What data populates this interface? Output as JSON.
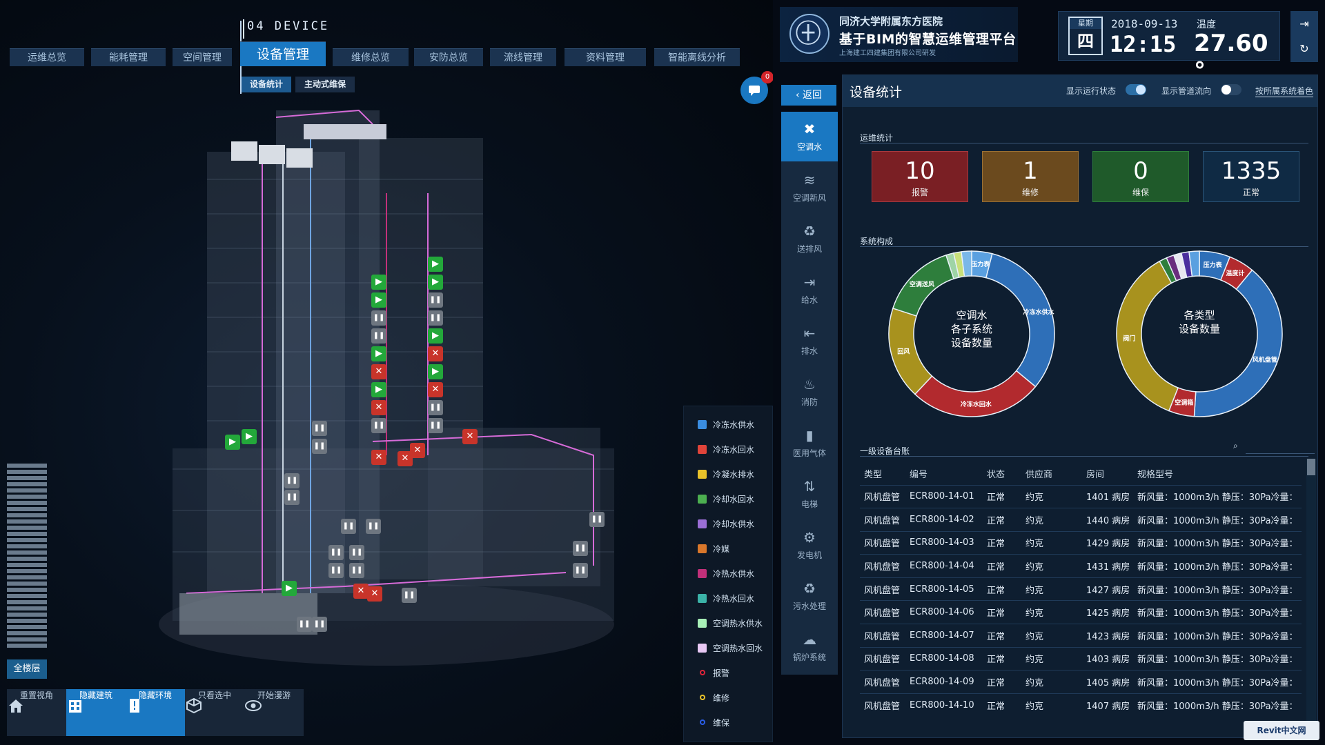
{
  "nav": {
    "device_label": "04 DEVICE",
    "tabs": [
      {
        "label": "运维总览",
        "active": false
      },
      {
        "label": "能耗管理",
        "active": false
      },
      {
        "label": "空间管理",
        "active": false
      },
      {
        "label": "设备管理",
        "active": true
      },
      {
        "label": "维修总览",
        "active": false
      },
      {
        "label": "安防总览",
        "active": false
      },
      {
        "label": "流线管理",
        "active": false
      },
      {
        "label": "资料管理",
        "active": false
      },
      {
        "label": "智能离线分析",
        "active": false
      }
    ],
    "subtabs": [
      {
        "label": "设备统计",
        "active": true
      },
      {
        "label": "主动式维保",
        "active": false
      }
    ]
  },
  "chat": {
    "badge": "0"
  },
  "header": {
    "hospital": "同济大学附属东方医院",
    "platform": "基于BIM的智慧运维管理平台",
    "company": "上海建工四建集团有限公司研发",
    "weekday_label": "星期",
    "weekday": "四",
    "date": "2018-09-13",
    "time": "12:15",
    "temp_label": "温度",
    "temp_value": "27.60 °"
  },
  "left": {
    "all_floors": "全楼层"
  },
  "toolbar": [
    {
      "label": "重置视角",
      "icon": "home-icon",
      "active": false
    },
    {
      "label": "隐藏建筑",
      "icon": "building-icon",
      "active": true
    },
    {
      "label": "隐藏环境",
      "icon": "environment-icon",
      "active": true
    },
    {
      "label": "只看选中",
      "icon": "cube-icon",
      "active": false
    },
    {
      "label": "开始漫游",
      "icon": "eye-icon",
      "active": false
    }
  ],
  "legend": [
    {
      "label": "冷冻水供水",
      "color": "#3a8de0",
      "kind": "swatch"
    },
    {
      "label": "冷冻水回水",
      "color": "#e0443a",
      "kind": "swatch"
    },
    {
      "label": "冷凝水排水",
      "color": "#e8c22a",
      "kind": "swatch"
    },
    {
      "label": "冷却水回水",
      "color": "#4caf50",
      "kind": "swatch"
    },
    {
      "label": "冷却水供水",
      "color": "#9b6fd6",
      "kind": "swatch"
    },
    {
      "label": "冷媒",
      "color": "#d9772b",
      "kind": "swatch"
    },
    {
      "label": "冷热水供水",
      "color": "#c2307a",
      "kind": "swatch"
    },
    {
      "label": "冷热水回水",
      "color": "#3bb3a8",
      "kind": "swatch"
    },
    {
      "label": "空调热水供水",
      "color": "#a8f0b8",
      "kind": "swatch"
    },
    {
      "label": "空调热水回水",
      "color": "#e8c8f4",
      "kind": "swatch"
    },
    {
      "label": "报警",
      "color": "#e0243a",
      "kind": "dot"
    },
    {
      "label": "维修",
      "color": "#e8c22a",
      "kind": "dot"
    },
    {
      "label": "维保",
      "color": "#2a5ee8",
      "kind": "dot"
    }
  ],
  "categories": [
    {
      "label": "空调水",
      "icon": "ac-icon",
      "glyph": "✖",
      "active": true
    },
    {
      "label": "空调新风",
      "icon": "wind-icon",
      "glyph": "≋",
      "active": false
    },
    {
      "label": "送排风",
      "icon": "recycle-icon",
      "glyph": "♻",
      "active": false
    },
    {
      "label": "给水",
      "icon": "water-in-icon",
      "glyph": "⇥",
      "active": false
    },
    {
      "label": "排水",
      "icon": "water-out-icon",
      "glyph": "⇤",
      "active": false
    },
    {
      "label": "消防",
      "icon": "fire-icon",
      "glyph": "♨",
      "active": false
    },
    {
      "label": "医用气体",
      "icon": "gas-cylinder-icon",
      "glyph": "▮",
      "active": false
    },
    {
      "label": "电梯",
      "icon": "elevator-icon",
      "glyph": "⇅",
      "active": false
    },
    {
      "label": "发电机",
      "icon": "generator-icon",
      "glyph": "⚙",
      "active": false
    },
    {
      "label": "污水处理",
      "icon": "sewage-icon",
      "glyph": "♻",
      "active": false
    },
    {
      "label": "锅炉系统",
      "icon": "boiler-icon",
      "glyph": "☁",
      "active": false
    }
  ],
  "back_label": "‹ 返回",
  "panel": {
    "title": "设备统计",
    "toggle_run_label": "显示运行状态",
    "toggle_run_on": true,
    "toggle_flow_label": "显示管道流向",
    "toggle_flow_on": false,
    "color_by": "按所属系统着色",
    "ops_section": "运维统计",
    "stats": [
      {
        "value": "10",
        "label": "报警",
        "bg": "#7a1f24",
        "border": "#a83a40"
      },
      {
        "value": "1",
        "label": "维修",
        "bg": "#6b4a1e",
        "border": "#9a7034"
      },
      {
        "value": "0",
        "label": "维保",
        "bg": "#1f5a2a",
        "border": "#2e7e3c"
      },
      {
        "value": "1335",
        "label": "正常",
        "bg": "#0f2a44",
        "border": "#2a5478"
      }
    ],
    "composition_section": "系统构成",
    "donut_left_center": [
      "空调水",
      "各子系统",
      "设备数量"
    ],
    "donut_right_center": [
      "各类型",
      "设备数量"
    ],
    "ledger_section": "一级设备台账",
    "ledger_headers": [
      "类型",
      "编号",
      "状态",
      "供应商",
      "房间",
      "规格型号"
    ],
    "ledger_rows": [
      [
        "风机盘管",
        "ECR800-14-01",
        "正常",
        "约克",
        "1401 病房",
        "新风量：1000m3/h 静压：30Pa冷量："
      ],
      [
        "风机盘管",
        "ECR800-14-02",
        "正常",
        "约克",
        "1440 病房",
        "新风量：1000m3/h 静压：30Pa冷量："
      ],
      [
        "风机盘管",
        "ECR800-14-03",
        "正常",
        "约克",
        "1429 病房",
        "新风量：1000m3/h 静压：30Pa冷量："
      ],
      [
        "风机盘管",
        "ECR800-14-04",
        "正常",
        "约克",
        "1431 病房",
        "新风量：1000m3/h 静压：30Pa冷量："
      ],
      [
        "风机盘管",
        "ECR800-14-05",
        "正常",
        "约克",
        "1427 病房",
        "新风量：1000m3/h 静压：30Pa冷量："
      ],
      [
        "风机盘管",
        "ECR800-14-06",
        "正常",
        "约克",
        "1425 病房",
        "新风量：1000m3/h 静压：30Pa冷量："
      ],
      [
        "风机盘管",
        "ECR800-14-07",
        "正常",
        "约克",
        "1423 病房",
        "新风量：1000m3/h 静压：30Pa冷量："
      ],
      [
        "风机盘管",
        "ECR800-14-08",
        "正常",
        "约克",
        "1403 病房",
        "新风量：1000m3/h 静压：30Pa冷量："
      ],
      [
        "风机盘管",
        "ECR800-14-09",
        "正常",
        "约克",
        "1405 病房",
        "新风量：1000m3/h 静压：30Pa冷量："
      ],
      [
        "风机盘管",
        "ECR800-14-10",
        "正常",
        "约克",
        "1407 病房",
        "新风量：1000m3/h 静压：30Pa冷量："
      ]
    ]
  },
  "chart_data": [
    {
      "type": "pie",
      "title": "空调水 各子系统 设备数量",
      "slices": [
        {
          "label": "压力表",
          "value": 4,
          "color": "#5aa0e0"
        },
        {
          "label": "冷冻水供水",
          "value": 32,
          "color": "#2e6fb8"
        },
        {
          "label": "冷冻水回水",
          "value": 26,
          "color": "#b22a2e"
        },
        {
          "label": "回风",
          "value": 18,
          "color": "#a8921e"
        },
        {
          "label": "空调送风",
          "value": 15,
          "color": "#2e7e3c"
        },
        {
          "label": "",
          "value": 1.5,
          "color": "#9fd4a6"
        },
        {
          "label": "",
          "value": 1.5,
          "color": "#c8e07a"
        },
        {
          "label": "",
          "value": 2,
          "color": "#7ab8e8"
        }
      ]
    },
    {
      "type": "pie",
      "title": "各类型 设备数量",
      "slices": [
        {
          "label": "压力表",
          "value": 6,
          "color": "#2e6fb8"
        },
        {
          "label": "温度计",
          "value": 5,
          "color": "#b22a2e"
        },
        {
          "label": "风机盘管",
          "value": 40,
          "color": "#2e6fb8"
        },
        {
          "label": "空调箱",
          "value": 5,
          "color": "#b22a2e"
        },
        {
          "label": "阀门",
          "value": 36,
          "color": "#a8921e"
        },
        {
          "label": "",
          "value": 1.5,
          "color": "#2e7e3c"
        },
        {
          "label": "",
          "value": 1.5,
          "color": "#6a2e7e"
        },
        {
          "label": "",
          "value": 1.5,
          "color": "#e8e8f0"
        },
        {
          "label": "",
          "value": 1.5,
          "color": "#4a2e9e"
        },
        {
          "label": "",
          "value": 2,
          "color": "#5aa0e0"
        }
      ]
    }
  ],
  "watermark": "Revit中文网"
}
